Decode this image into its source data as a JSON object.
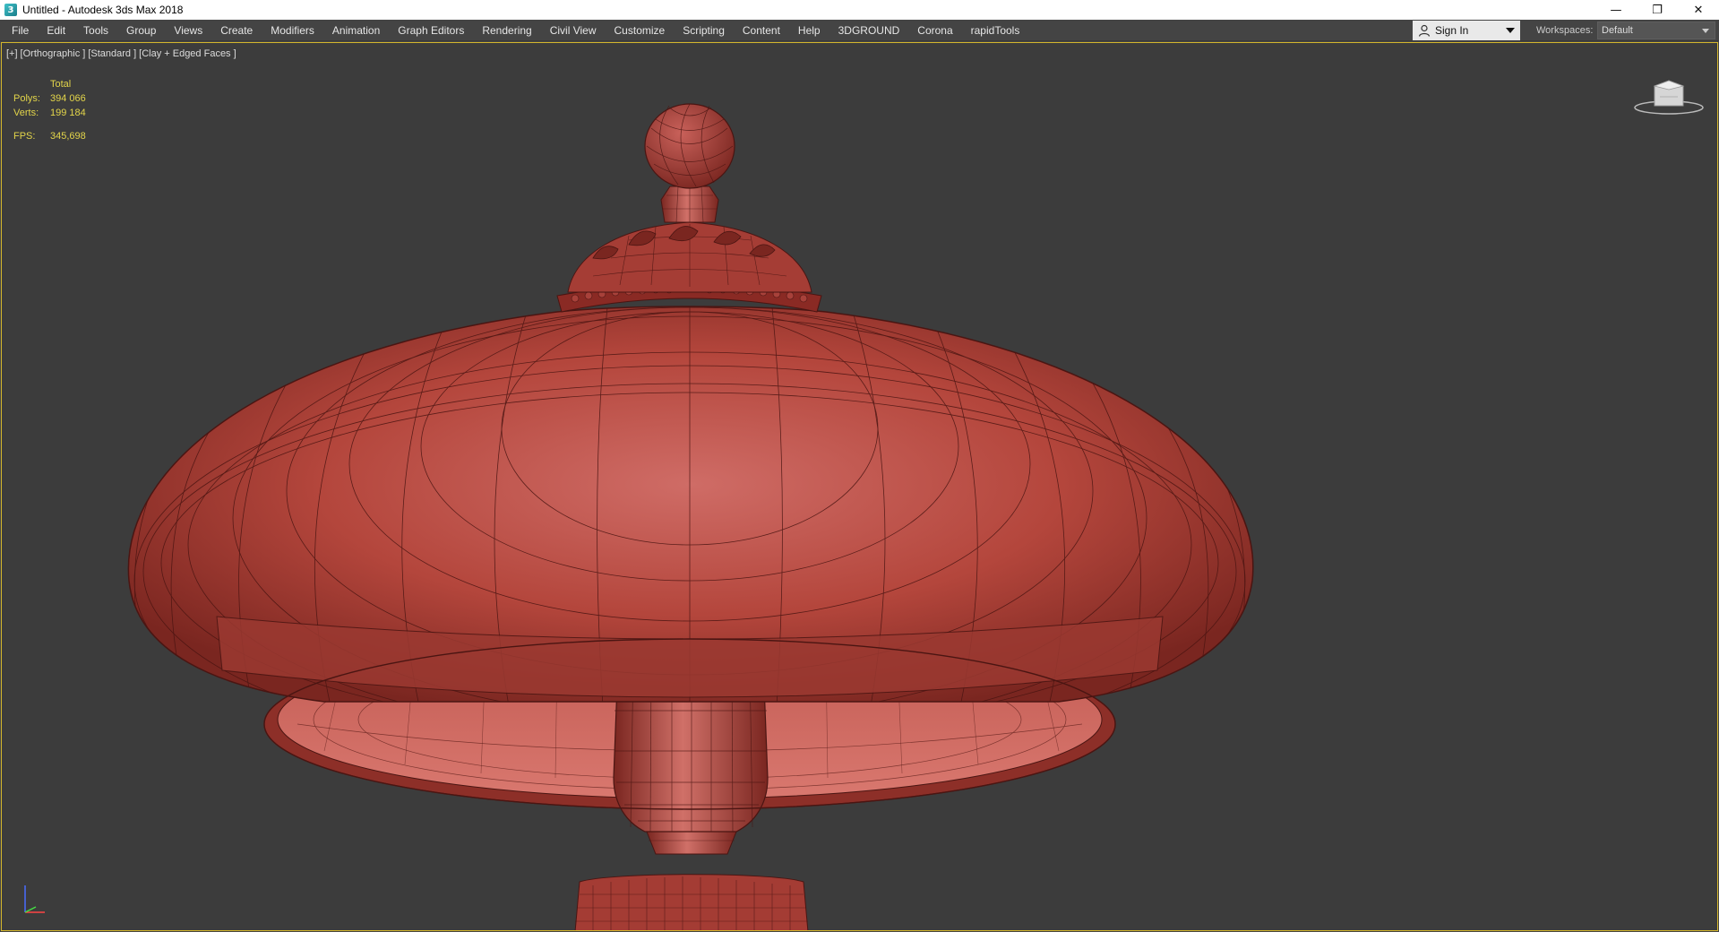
{
  "window": {
    "title": "Untitled - Autodesk 3ds Max 2018",
    "app_icon_glyph": "3",
    "controls": {
      "minimize": "—",
      "restore": "❐",
      "close": "✕"
    }
  },
  "menu": {
    "items": [
      "File",
      "Edit",
      "Tools",
      "Group",
      "Views",
      "Create",
      "Modifiers",
      "Animation",
      "Graph Editors",
      "Rendering",
      "Civil View",
      "Customize",
      "Scripting",
      "Content",
      "Help",
      "3DGROUND",
      "Corona",
      "rapidTools"
    ]
  },
  "account": {
    "signin_label": "Sign In"
  },
  "workspace": {
    "label": "Workspaces:",
    "value": "Default"
  },
  "viewport": {
    "label_parts": [
      "[+]",
      "[Orthographic ]",
      "[Standard ]",
      "[Clay + Edged Faces ]"
    ],
    "stats": {
      "header": "Total",
      "polys_label": "Polys:",
      "polys_value": "394 066",
      "verts_label": "Verts:",
      "verts_value": "199 184",
      "fps_label": "FPS:",
      "fps_value": "345,698"
    },
    "model_color": "#b4463c",
    "wire_color": "#4a1512",
    "background_color": "#3c3c3c",
    "border_color": "#d4b62c",
    "stats_color": "#e3d54a"
  }
}
